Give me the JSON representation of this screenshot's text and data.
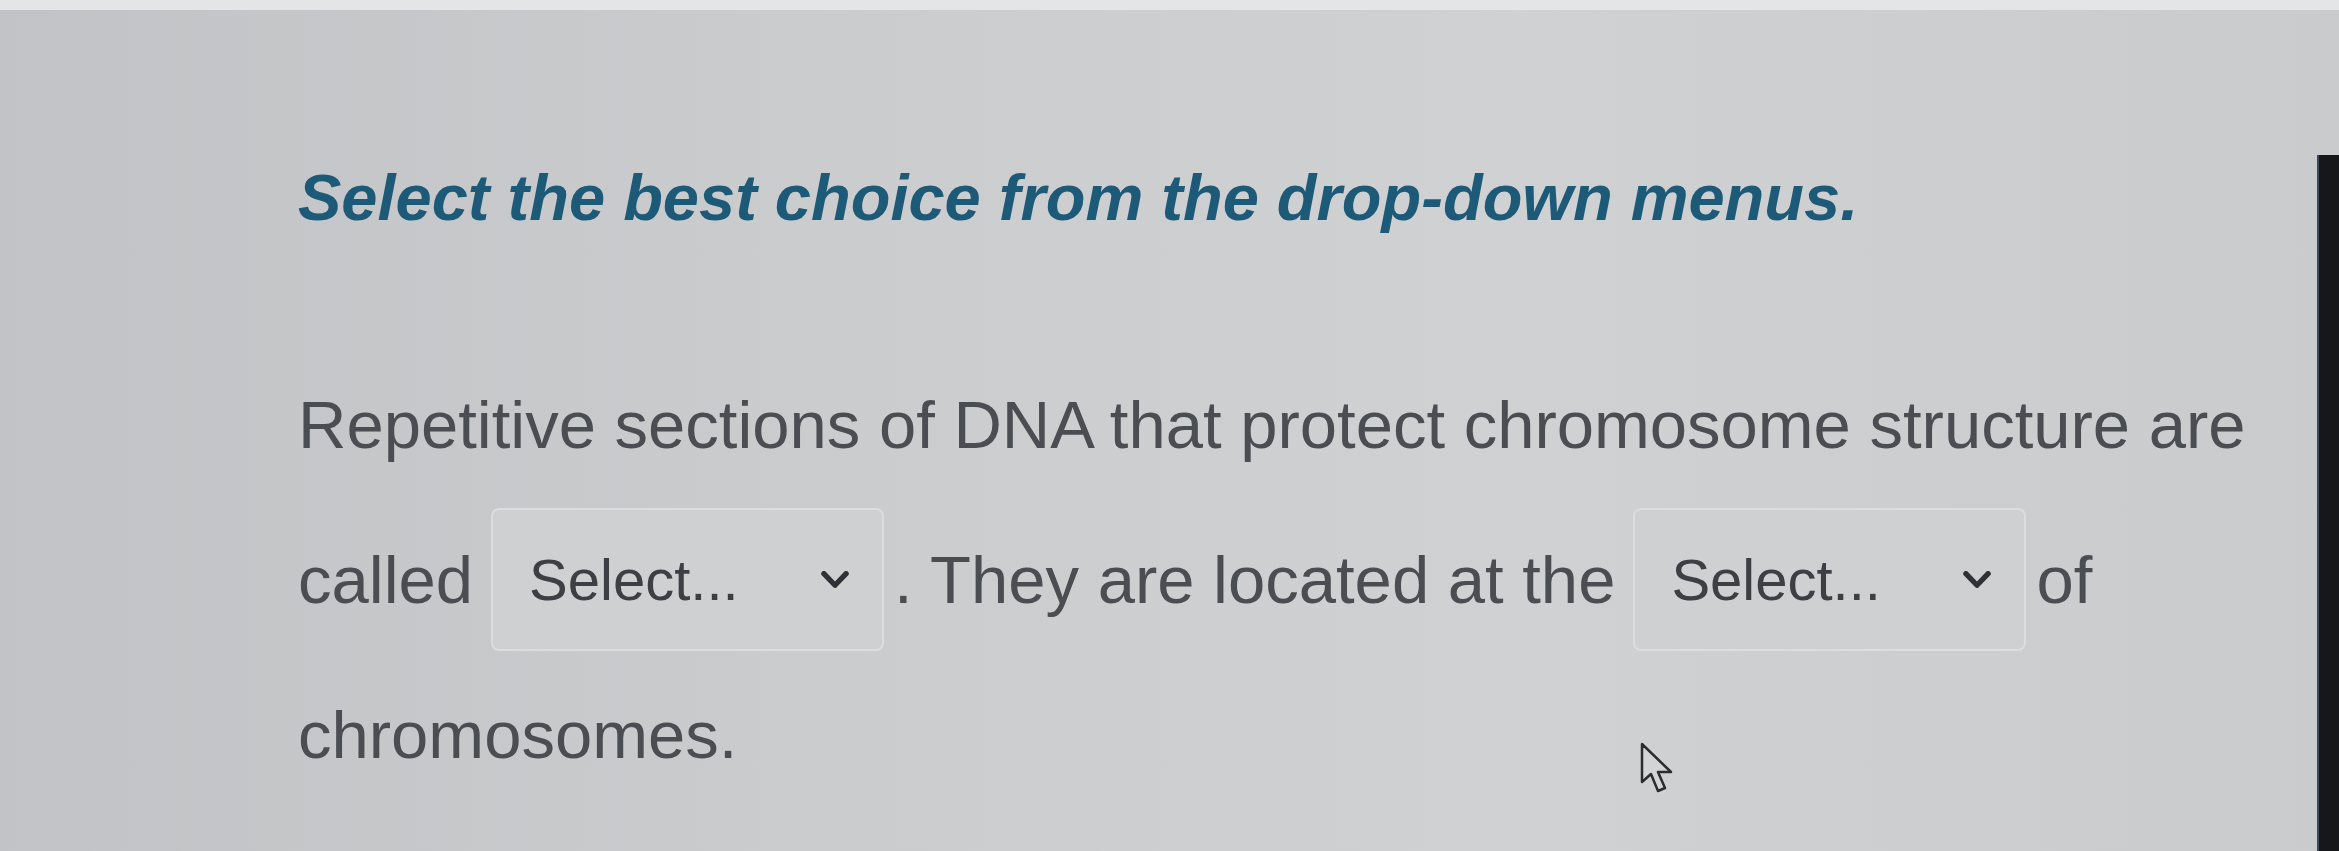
{
  "instruction": "Select the best choice from the drop-down menus.",
  "question": {
    "lines": [
      {
        "segments": [
          {
            "kind": "text",
            "text": "Repetitive sections of DNA that protect chromosome structure are"
          }
        ]
      },
      {
        "segments": [
          {
            "kind": "text",
            "text": "called"
          },
          {
            "kind": "dropdown",
            "placeholder": "Select..."
          },
          {
            "kind": "text",
            "text": ". They are located at the"
          },
          {
            "kind": "dropdown",
            "placeholder": "Select..."
          },
          {
            "kind": "text",
            "text": "of"
          }
        ]
      },
      {
        "segments": [
          {
            "kind": "text",
            "text": "chromosomes."
          }
        ]
      }
    ]
  }
}
